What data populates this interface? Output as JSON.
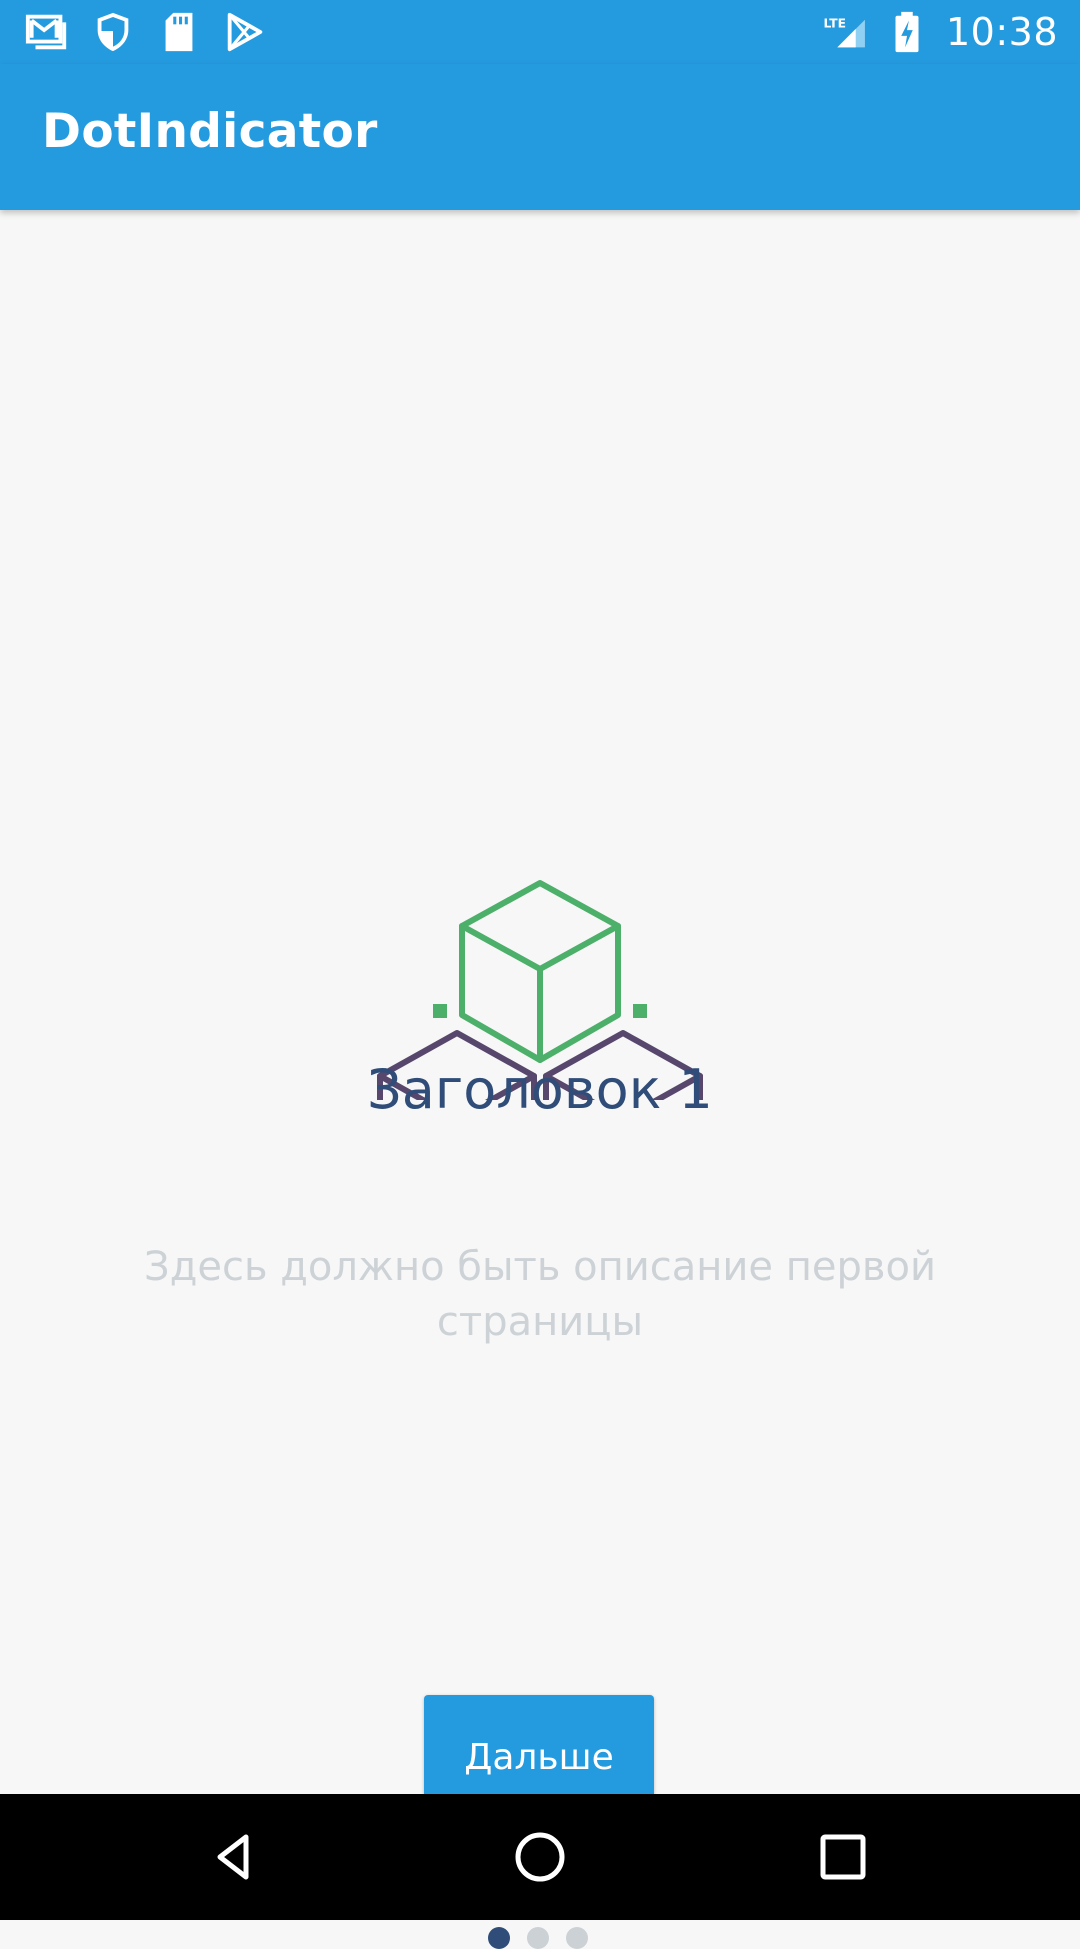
{
  "status_bar": {
    "time": "10:38",
    "network": "LTE",
    "left_icons": [
      "gmail-icon",
      "shield-icon",
      "sd-card-icon",
      "play-store-icon"
    ],
    "right_icons": [
      "lte-signal-icon",
      "battery-charging-icon"
    ]
  },
  "app_bar": {
    "title": "DotIndicator"
  },
  "page": {
    "illustration": "cubes-icon",
    "title": "Заголовок 1",
    "description": "Здесь должно быть описание первой страницы",
    "next_button_label": "Дальше"
  },
  "indicator": {
    "total": 3,
    "active_index": 0
  },
  "nav_bar": {
    "buttons": [
      "back-icon",
      "home-icon",
      "recents-icon"
    ]
  },
  "colors": {
    "primary": "#259bdf",
    "title_text": "#2f4d78",
    "description_text": "#cdd2d7",
    "background": "#f6f7f6",
    "cube_green": "#4caf6a",
    "cube_purple": "#57476d",
    "dot_inactive": "#ccd1d6",
    "dot_active": "#2f4d78"
  }
}
